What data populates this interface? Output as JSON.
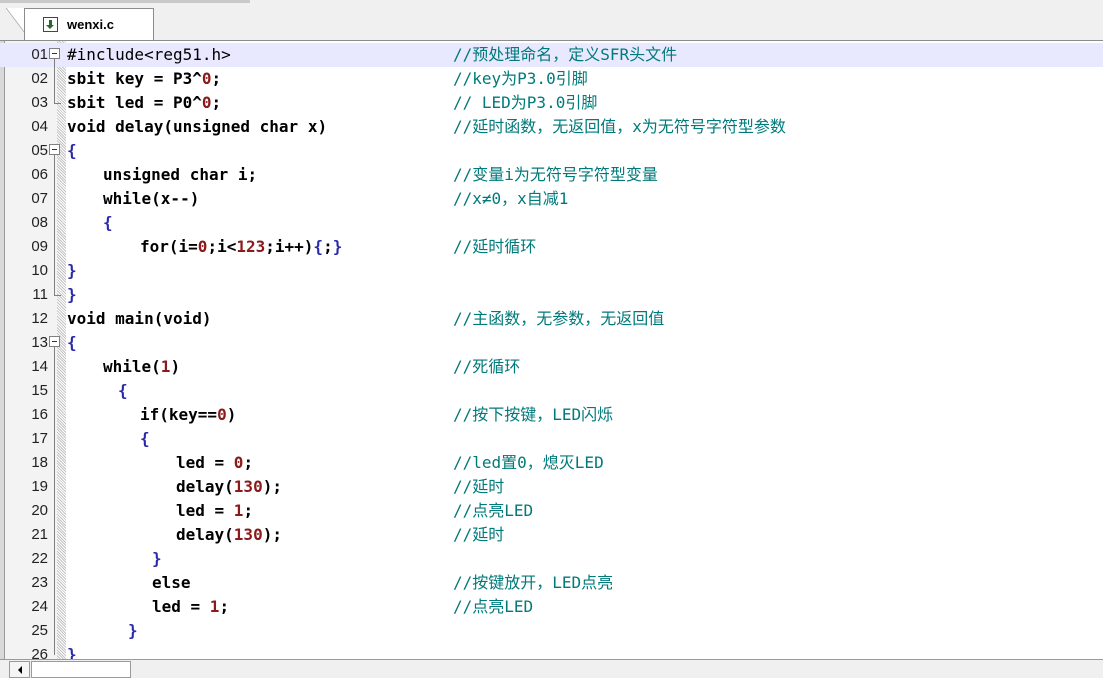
{
  "tab": {
    "label": "wenxi.c",
    "icon": "c-file-icon"
  },
  "lines": [
    {
      "num": "01",
      "code": "#include<reg51.h>",
      "comment": "//预处理命名，定义SFR头文件"
    },
    {
      "num": "02",
      "code": "sbit key = P3^0;",
      "comment": "//key为P3.0引脚"
    },
    {
      "num": "03",
      "code": "sbit led = P0^0;",
      "comment": "// LED为P3.0引脚"
    },
    {
      "num": "04",
      "code": "void delay(unsigned char x)",
      "comment": "//延时函数，无返回值，x为无符号字符型参数"
    },
    {
      "num": "05",
      "code": "{",
      "comment": ""
    },
    {
      "num": "06",
      "code": "unsigned char i;",
      "comment": "//变量i为无符号字符型变量"
    },
    {
      "num": "07",
      "code": "while(x--)",
      "comment": "//x≠0，x自减1"
    },
    {
      "num": "08",
      "code": "{",
      "comment": ""
    },
    {
      "num": "09",
      "code": "for(i=0;i<123;i++){;}",
      "comment": "//延时循环"
    },
    {
      "num": "10",
      "code": "}",
      "comment": ""
    },
    {
      "num": "11",
      "code": "}",
      "comment": ""
    },
    {
      "num": "12",
      "code": "void main(void)",
      "comment": "//主函数，无参数，无返回值"
    },
    {
      "num": "13",
      "code": "{",
      "comment": ""
    },
    {
      "num": "14",
      "code": "while(1)",
      "comment": "//死循环"
    },
    {
      "num": "15",
      "code": "{",
      "comment": ""
    },
    {
      "num": "16",
      "code": "if(key==0)",
      "comment": "//按下按键，LED闪烁"
    },
    {
      "num": "17",
      "code": "{",
      "comment": ""
    },
    {
      "num": "18",
      "code": "led = 0;",
      "comment": "//led置0，熄灭LED"
    },
    {
      "num": "19",
      "code": "delay(130);",
      "comment": "//延时"
    },
    {
      "num": "20",
      "code": "led = 1;",
      "comment": "//点亮LED"
    },
    {
      "num": "21",
      "code": "delay(130);",
      "comment": "//延时"
    },
    {
      "num": "22",
      "code": "}",
      "comment": ""
    },
    {
      "num": "23",
      "code": "else",
      "comment": "//按键放开，LED点亮"
    },
    {
      "num": "24",
      "code": "led = 1;",
      "comment": "//点亮LED"
    },
    {
      "num": "25",
      "code": "}",
      "comment": ""
    },
    {
      "num": "26",
      "code": "}",
      "comment": ""
    }
  ],
  "colors": {
    "comment": "#007a7a",
    "number": "#8b1a1a",
    "brace": "#2a2aa8",
    "current_line": "#e8e8ff"
  }
}
